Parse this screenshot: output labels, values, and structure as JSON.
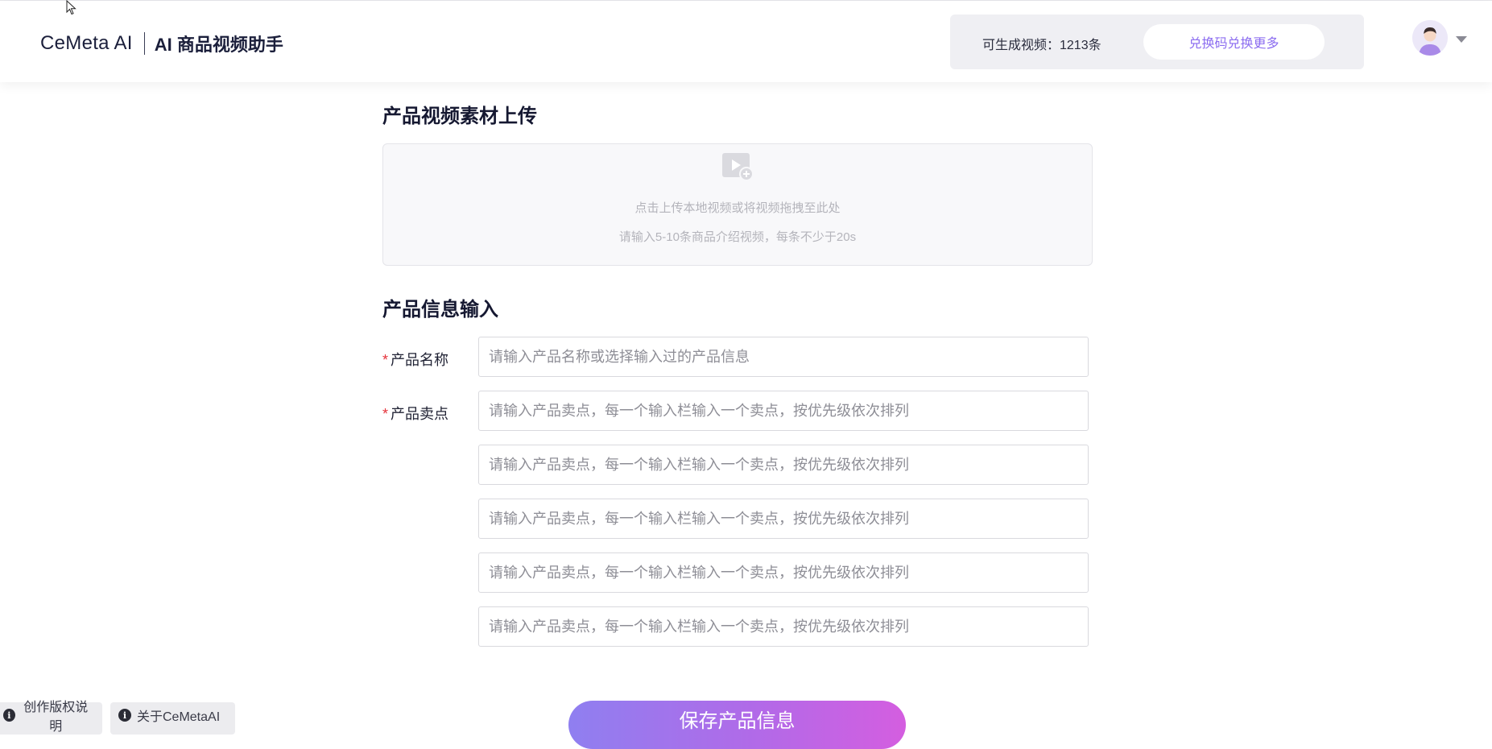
{
  "header": {
    "brand": "CeMeta AI",
    "product": "AI 商品视频助手",
    "quota_text": "可生成视频：1213条",
    "redeem_label": "兑换码兑换更多",
    "avatar_icon": "user-avatar",
    "caret_icon": "caret-down-icon"
  },
  "upload": {
    "title": "产品视频素材上传",
    "icon": "video-add-icon",
    "line1": "点击上传本地视频或将视频拖拽至此处",
    "line2": "请输入5-10条商品介绍视频，每条不少于20s"
  },
  "info": {
    "title": "产品信息输入",
    "required_mark": "*",
    "name_label": "产品名称",
    "name_placeholder": "请输入产品名称或选择输入过的产品信息",
    "selling_label": "产品卖点",
    "selling_placeholders": [
      "请输入产品卖点，每一个输入栏输入一个卖点，按优先级依次排列",
      "请输入产品卖点，每一个输入栏输入一个卖点，按优先级依次排列",
      "请输入产品卖点，每一个输入栏输入一个卖点，按优先级依次排列",
      "请输入产品卖点，每一个输入栏输入一个卖点，按优先级依次排列",
      "请输入产品卖点，每一个输入栏输入一个卖点，按优先级依次排列"
    ]
  },
  "actions": {
    "save_label": "保存产品信息"
  },
  "footer": {
    "copyright_label": "创作版权说明",
    "about_label": "关于CeMetaAI",
    "info_glyph": "i"
  },
  "colors": {
    "accent": "#8b6cf0",
    "gradient_start": "#8f7ff0",
    "gradient_end": "#d45ee0",
    "required": "#e5323a"
  }
}
